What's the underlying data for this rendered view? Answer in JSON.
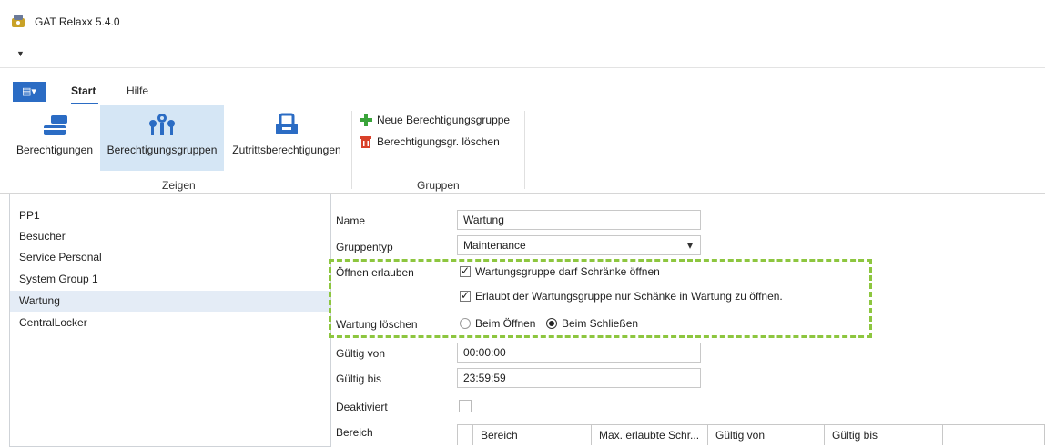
{
  "window": {
    "title": "GAT Relaxx 5.4.0",
    "icon": "app-logo-icon",
    "qat_icon": "dropdown-arrow-icon"
  },
  "ribbon": {
    "file_icon": "menu-icon",
    "tabs": [
      {
        "label": "Start",
        "active": true
      },
      {
        "label": "Hilfe"
      }
    ],
    "buttons": {
      "berechtigungen": "Berechtigungen",
      "berechtigungsgruppen": "Berechtigungsgruppen",
      "zutrittsberechtigungen": "Zutrittsberechtigungen"
    },
    "group_zeigen": "Zeigen",
    "neu": "Neue Berechtigungsgruppe",
    "loeschen": "Berechtigungsgr. löschen",
    "group_gruppen": "Gruppen",
    "accent": "#2b6cc4"
  },
  "list": {
    "items": [
      "PP1",
      "Besucher",
      "Service Personal",
      "System Group 1",
      "Wartung",
      "CentralLocker"
    ],
    "selected": "Wartung"
  },
  "form": {
    "name_label": "Name",
    "name_value": "Wartung",
    "gtype_label": "Gruppentyp",
    "gtype_value": "Maintenance",
    "oeffnen_label": "Öffnen erlauben",
    "cb1_label": "Wartungsgruppe darf Schränke öffnen",
    "cb1_checked": true,
    "cb2_label": "Erlaubt der Wartungsgruppe nur Schänke in Wartung zu öffnen.",
    "cb2_checked": true,
    "wartung_label": "Wartung löschen",
    "radio1": "Beim Öffnen",
    "radio2": "Beim Schließen",
    "radio_selected": "Beim Schließen",
    "von_label": "Gültig von",
    "von_value": "00:00:00",
    "bis_label": "Gültig bis",
    "bis_value": "23:59:59",
    "deakt_label": "Deaktiviert",
    "deakt_checked": false,
    "bereich_label": "Bereich",
    "highlight_color": "#8dc63f"
  },
  "grid": {
    "columns": [
      "Bereich",
      "Max. erlaubte Schr...",
      "Gültig von",
      "Gültig bis"
    ]
  }
}
